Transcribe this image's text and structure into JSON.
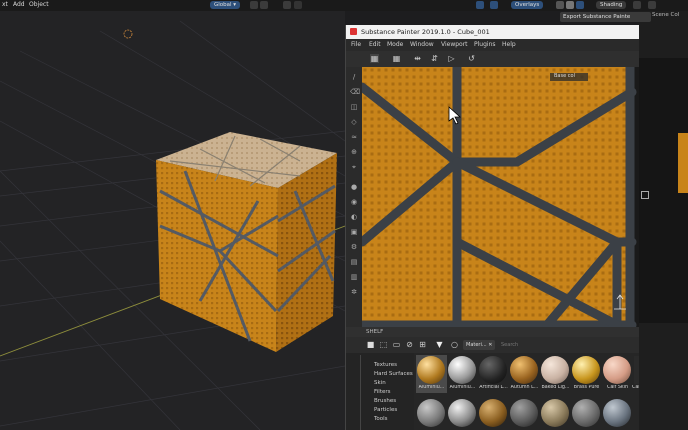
{
  "blender": {
    "menu": [
      "xt",
      "Add",
      "Object"
    ],
    "orientation": "Global",
    "overlays_label": "Overlays",
    "shading_label": "Shading",
    "export_button": "Export Substance Painte",
    "scene_col": "Scene Col"
  },
  "painter": {
    "title": "Substance Painter 2019.1.0 - Cube_001",
    "menu": [
      "File",
      "Edit",
      "Mode",
      "Window",
      "Viewport",
      "Plugins",
      "Help"
    ],
    "canvas_label": "Base col",
    "shelf_title": "SHELF",
    "search_tag": "Materi...",
    "search_placeholder": "Search",
    "categories": [
      "Textures",
      "Hard Surfaces",
      "Skin",
      "Filters",
      "Brushes",
      "Particles",
      "Tools"
    ],
    "materials_row1": [
      "Aluminiu...",
      "Aluminiu...",
      "Artificial L...",
      "Autumn L...",
      "Baked Lig...",
      "Brass Pure",
      "Calf Skin",
      "Carbon Fi..."
    ]
  },
  "colors": {
    "accent": "#2d4f7a",
    "gold": "#c8841a",
    "groove": "#3b4046"
  }
}
